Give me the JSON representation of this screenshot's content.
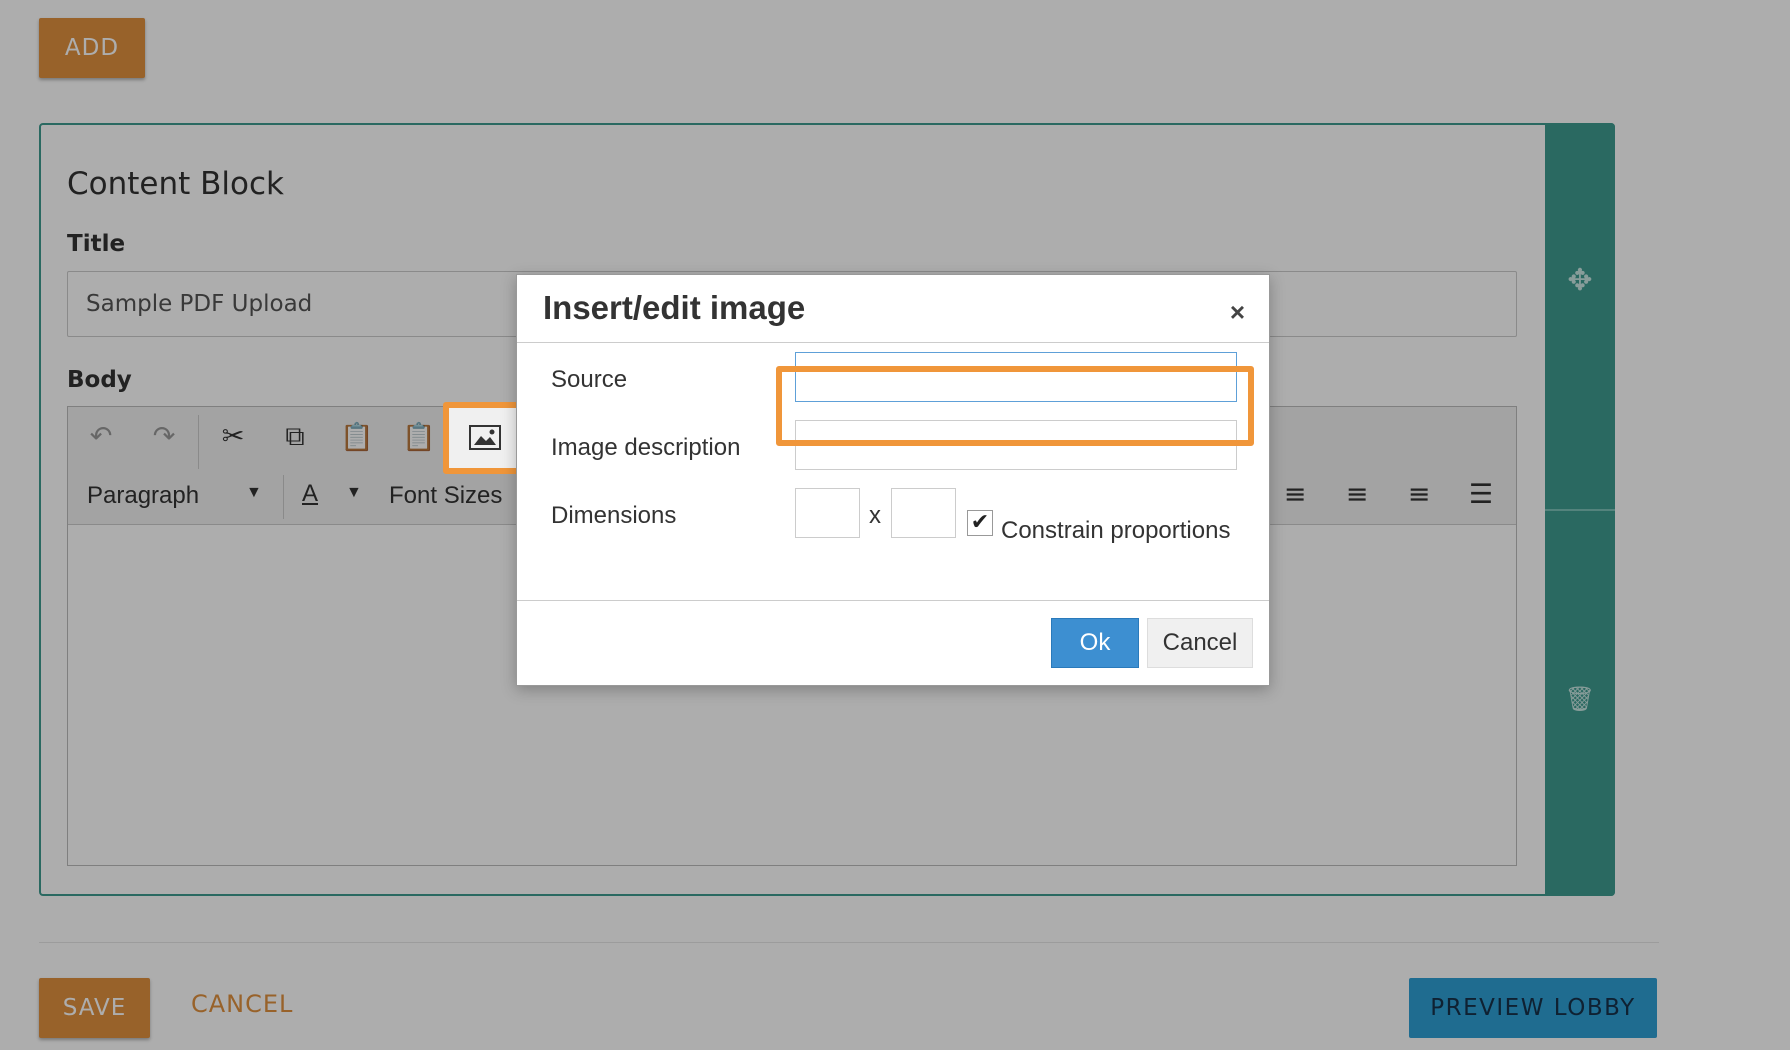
{
  "header": {
    "add_label": "ADD"
  },
  "content_block": {
    "heading": "Content Block",
    "title_label": "Title",
    "title_value": "Sample PDF Upload",
    "body_label": "Body",
    "toolbar": {
      "format_select": "Paragraph",
      "text_color_glyph": "A",
      "font_sizes_label": "Font Sizes"
    }
  },
  "dialog": {
    "title": "Insert/edit image",
    "close_glyph": "×",
    "source_label": "Source",
    "source_value": "",
    "description_label": "Image description",
    "dimensions_label": "Dimensions",
    "dimensions_separator": "x",
    "constrain_label": "Constrain proportions",
    "constrain_checked": true,
    "ok_label": "Ok",
    "cancel_label": "Cancel"
  },
  "footer": {
    "save_label": "SAVE",
    "cancel_label": "CANCEL",
    "preview_label": "PREVIEW LOBBY"
  },
  "colors": {
    "accent_orange": "#e0913f",
    "highlight_orange": "#f0963a",
    "teal": "#3f9b90",
    "preview_blue": "#2f9fd4",
    "ok_blue": "#3d8fd1"
  },
  "icons": [
    "move-icon",
    "trash-icon",
    "undo-icon",
    "redo-icon",
    "cut-icon",
    "copy-icon",
    "paste-icon",
    "paste-text-icon",
    "image-icon",
    "align-left-icon",
    "align-center-icon",
    "align-right-icon",
    "align-justify-icon"
  ]
}
